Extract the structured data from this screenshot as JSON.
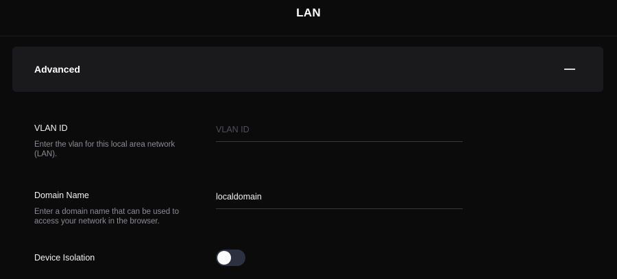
{
  "header": {
    "title": "LAN"
  },
  "section": {
    "title": "Advanced",
    "collapse_icon": "minus-icon"
  },
  "fields": {
    "vlan": {
      "label": "VLAN ID",
      "description": "Enter the vlan for this local area network (LAN).",
      "value": "",
      "placeholder": "VLAN ID"
    },
    "domain": {
      "label": "Domain Name",
      "description": "Enter a domain name that can be used to access your network in the browser.",
      "value": "localdomain",
      "placeholder": ""
    },
    "isolation": {
      "label": "Device Isolation",
      "enabled": false
    }
  },
  "colors": {
    "background": "#0b0b0c",
    "card": "#1a1a1c",
    "toggle_off": "#2c3140",
    "text_muted": "#8c8c90"
  }
}
